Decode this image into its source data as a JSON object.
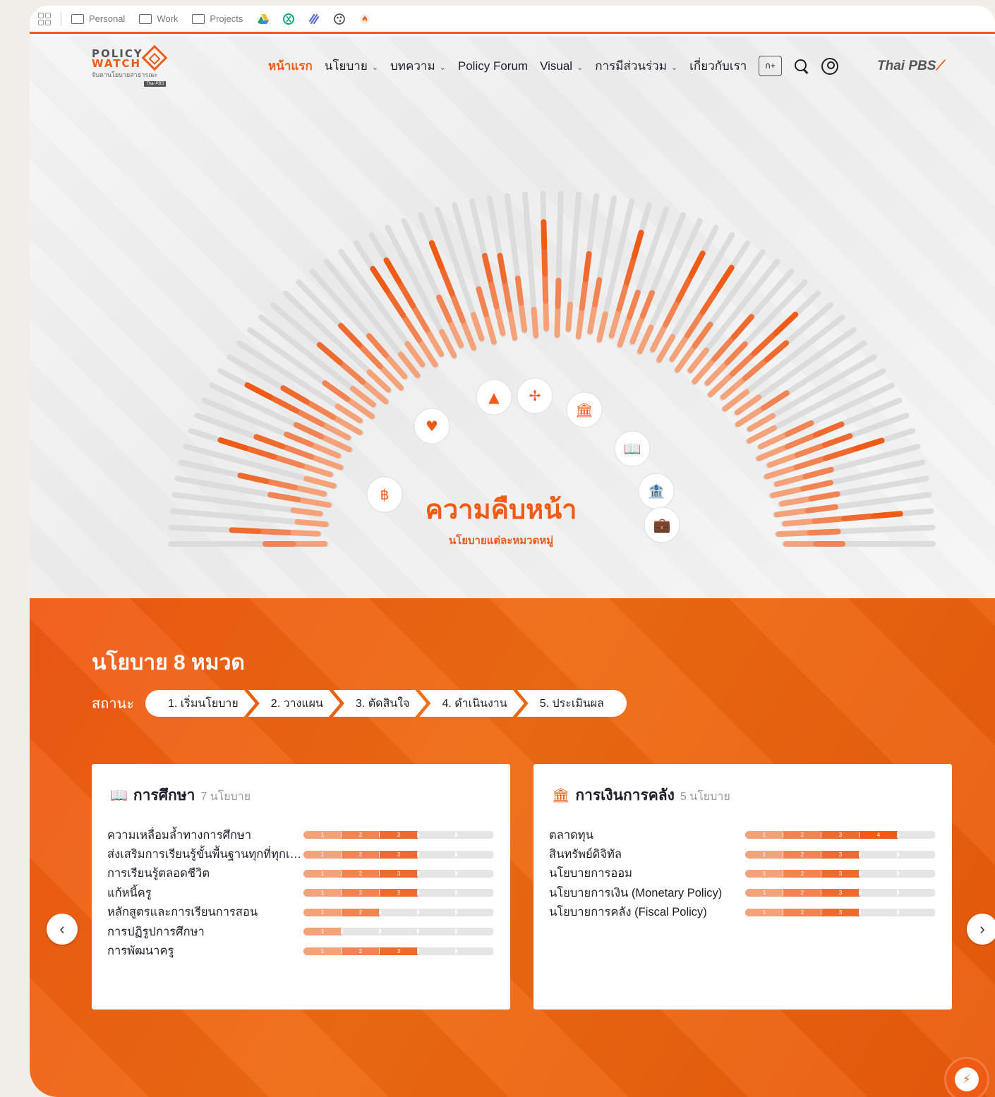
{
  "bookmarks": [
    {
      "label": "Personal"
    },
    {
      "label": "Work"
    },
    {
      "label": "Projects"
    }
  ],
  "bookmark_icons": [
    "drive-icon",
    "openai-icon",
    "linear-icon",
    "figma-icon",
    "extension-icon"
  ],
  "logo": {
    "line1": "POLICY",
    "line2": "WATCH",
    "line3": "จับตานโยบายสาธารณะ",
    "tag": "Thai PBS"
  },
  "nav": {
    "home": "หน้าแรก",
    "policy": "นโยบาย",
    "articles": "บทความ",
    "forum": "Policy Forum",
    "visual": "Visual",
    "participation": "การมีส่วนร่วม",
    "about": "เกี่ยวกับเรา",
    "font_size": "ก+"
  },
  "brand": "Thai PBS",
  "hero": {
    "title": "ความคืบหน้า",
    "subtitle": "นโยบายแต่ละหมวดหมู่"
  },
  "colors": {
    "accent": "#ef5a14",
    "bar_light": "#f4a27a",
    "bar_mid": "#f28454",
    "bar_track": "#e5e5e5"
  },
  "section": {
    "title": "นโยบาย 8 หมวด",
    "status_label": "สถานะ",
    "stages": [
      "1. เริ่มนโยบาย",
      "2. วางแผน",
      "3. ตัดสินใจ",
      "4. ดำเนินงาน",
      "5. ประเมินผล"
    ]
  },
  "cards": [
    {
      "icon": "book-icon",
      "title": "การศึกษา",
      "count": "7 นโยบาย",
      "rows": [
        {
          "label": "ความเหลื่อมล้ำทางการศึกษา",
          "stage": 3
        },
        {
          "label": "ส่งเสริมการเรียนรู้ขั้นพื้นฐานทุกที่ทุกเวลา",
          "stage": 3
        },
        {
          "label": "การเรียนรู้ตลอดชีวิต",
          "stage": 3
        },
        {
          "label": "แก้หนี้ครู",
          "stage": 3
        },
        {
          "label": "หลักสูตรและการเรียนการสอน",
          "stage": 2
        },
        {
          "label": "การปฏิรูปการศึกษา",
          "stage": 1
        },
        {
          "label": "การพัฒนาครู",
          "stage": 3
        }
      ]
    },
    {
      "icon": "bank-icon",
      "title": "การเงินการคลัง",
      "count": "5 นโยบาย",
      "rows": [
        {
          "label": "ตลาดทุน",
          "stage": 4
        },
        {
          "label": "สินทรัพย์ดิจิทัล",
          "stage": 3
        },
        {
          "label": "นโยบายการออม",
          "stage": 3
        },
        {
          "label": "นโยบายการเงิน (Monetary Policy)",
          "stage": 3
        },
        {
          "label": "นโยบายการคลัง (Fiscal Policy)",
          "stage": 3
        }
      ]
    }
  ],
  "carousel": {
    "prev": "‹",
    "next": "›"
  }
}
